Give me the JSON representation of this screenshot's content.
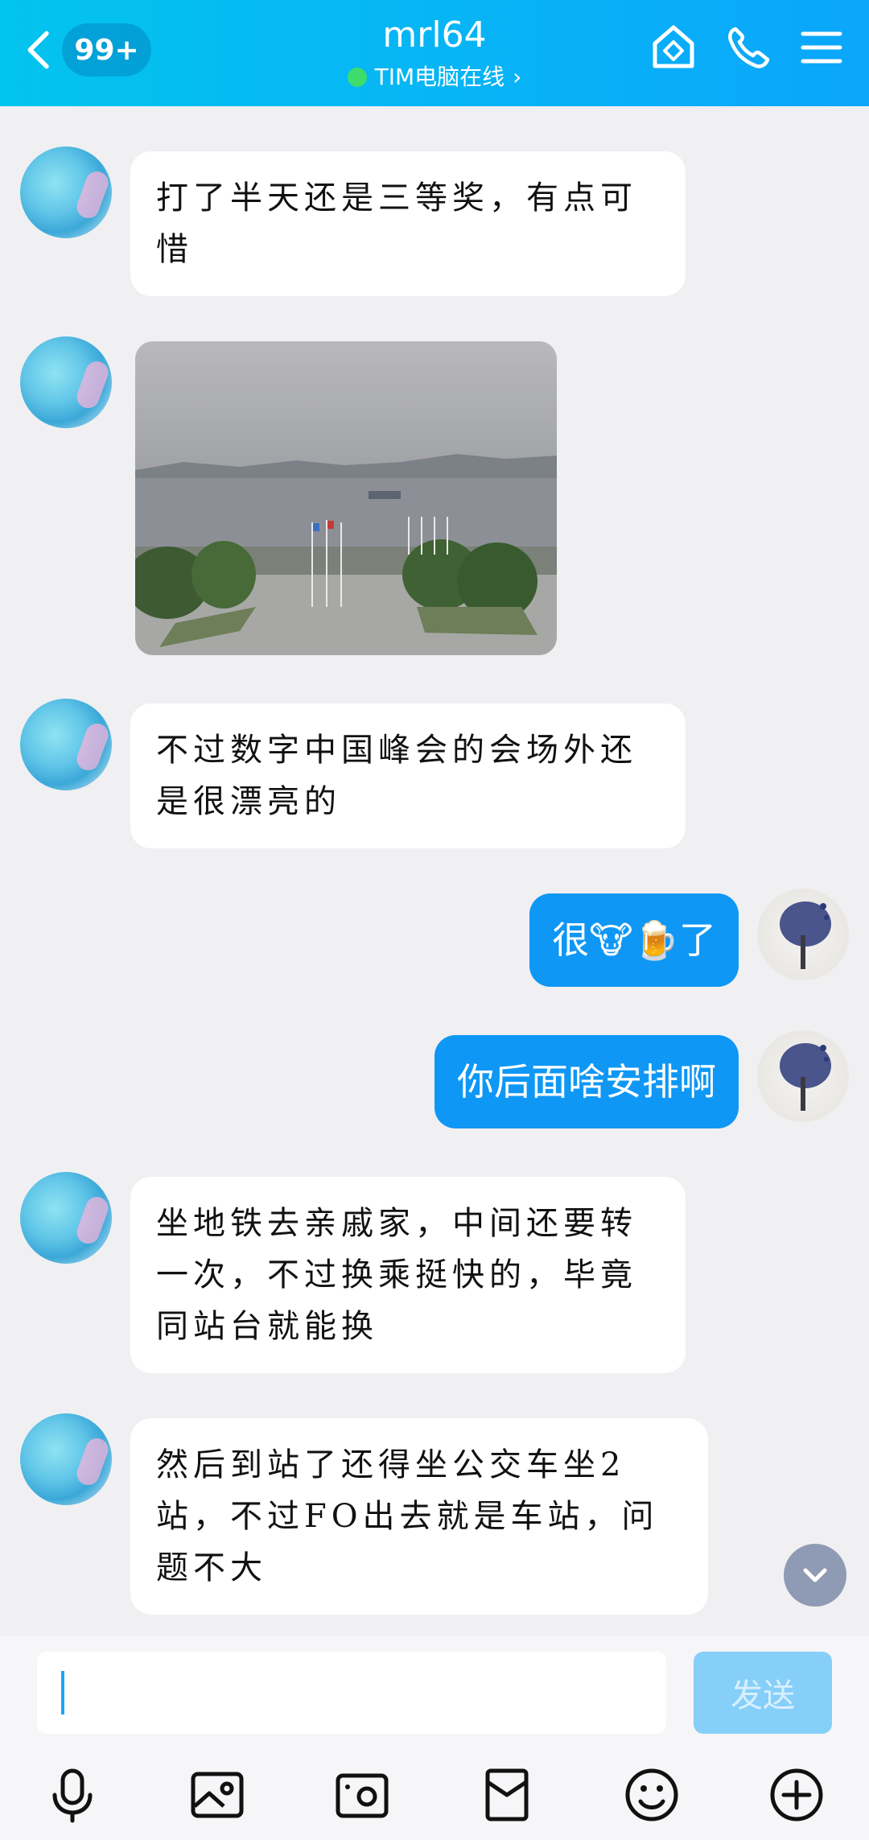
{
  "header": {
    "unread_badge": "99+",
    "title": "mrl64",
    "status": "TIM电脑在线",
    "status_chevron": "›",
    "icons": [
      "back-arrow-icon",
      "home-shield-icon",
      "phone-icon",
      "menu-icon"
    ],
    "accent": "#0ba6fb"
  },
  "messages": [
    {
      "side": "in",
      "text": "打了半天还是三等奖，有点可惜"
    },
    {
      "side": "in",
      "type": "image",
      "alt_icon": "lake-photo"
    },
    {
      "side": "in",
      "text": "不过数字中国峰会的会场外还是很漂亮的"
    },
    {
      "side": "out",
      "text": "很🐮🍺了"
    },
    {
      "side": "out",
      "text": "你后面啥安排啊"
    },
    {
      "side": "in",
      "text": "坐地铁去亲戚家，中间还要转一次，不过换乘挺快的，毕竟同站台就能换"
    },
    {
      "side": "in",
      "text": "然后到站了还得坐公交车坐2站，不过FO出去就是车站，问题不大"
    }
  ],
  "input": {
    "value": "",
    "send_label": "发送"
  },
  "toolbar": {
    "icons": [
      "microphone-icon",
      "image-icon",
      "camera-icon",
      "red-packet-icon",
      "emoji-icon",
      "plus-icon"
    ]
  },
  "colors": {
    "incoming_bubble": "#ffffff",
    "outgoing_bubble": "#0f97f5",
    "background": "#f0f0f2",
    "send_disabled": "#86cff9"
  }
}
